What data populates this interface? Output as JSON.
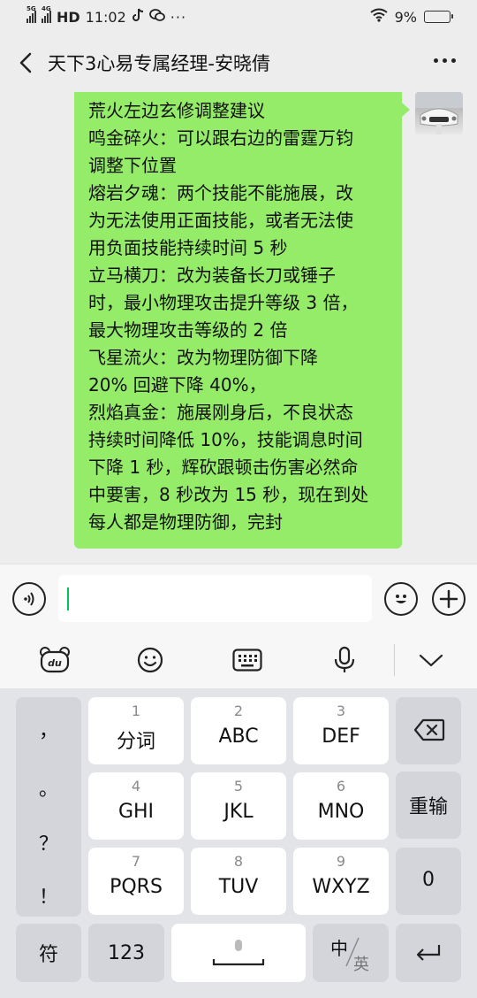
{
  "status_bar": {
    "network_1": "5G",
    "network_2": "4G",
    "hd": "HD",
    "time": "11:02",
    "battery": "9%",
    "battery_level": 0.09,
    "icons": [
      "tiktok-icon",
      "wechat-icon",
      "more-dots-icon",
      "wifi-icon",
      "battery-icon"
    ]
  },
  "header": {
    "title": "天下3心易专属经理-安晓倩"
  },
  "message": {
    "lines": [
      "荒火左边玄修调整建议",
      "鸣金碎火：可以跟右边的雷霆万钧",
      "调整下位置",
      "熔岩夕魂：两个技能不能施展，改",
      "为无法使用正面技能，或者无法使",
      "用负面技能持续时间 5 秒",
      "立马横刀：改为装备长刀或锤子",
      "时，最小物理攻击提升等级 3 倍，",
      "最大物理攻击等级的 2 倍",
      "飞星流火：改为物理防御下降",
      "20% 回避下降 40%，",
      "烈焰真金：施展刚身后，不良状态",
      "持续时间降低 10%，技能调息时间",
      "下降 1 秒，辉砍跟顿击伤害必然命",
      "中要害，8 秒改为 15 秒，现在到处",
      "每人都是物理防御，完封"
    ]
  },
  "keyboard": {
    "punctuation": [
      "，",
      "。",
      "？",
      "！"
    ],
    "keys": [
      {
        "num": "1",
        "label": "分词"
      },
      {
        "num": "2",
        "label": "ABC"
      },
      {
        "num": "3",
        "label": "DEF"
      },
      {
        "num": "4",
        "label": "GHI"
      },
      {
        "num": "5",
        "label": "JKL"
      },
      {
        "num": "6",
        "label": "MNO"
      },
      {
        "num": "7",
        "label": "PQRS"
      },
      {
        "num": "8",
        "label": "TUV"
      },
      {
        "num": "9",
        "label": "WXYZ"
      }
    ],
    "reenter": "重输",
    "zero": "0",
    "symbol": "符",
    "numbers": "123",
    "lang_cn": "中",
    "lang_en": "英"
  },
  "colors": {
    "bubble": "#95ec69",
    "accent": "#07c160",
    "background": "#ededed"
  }
}
